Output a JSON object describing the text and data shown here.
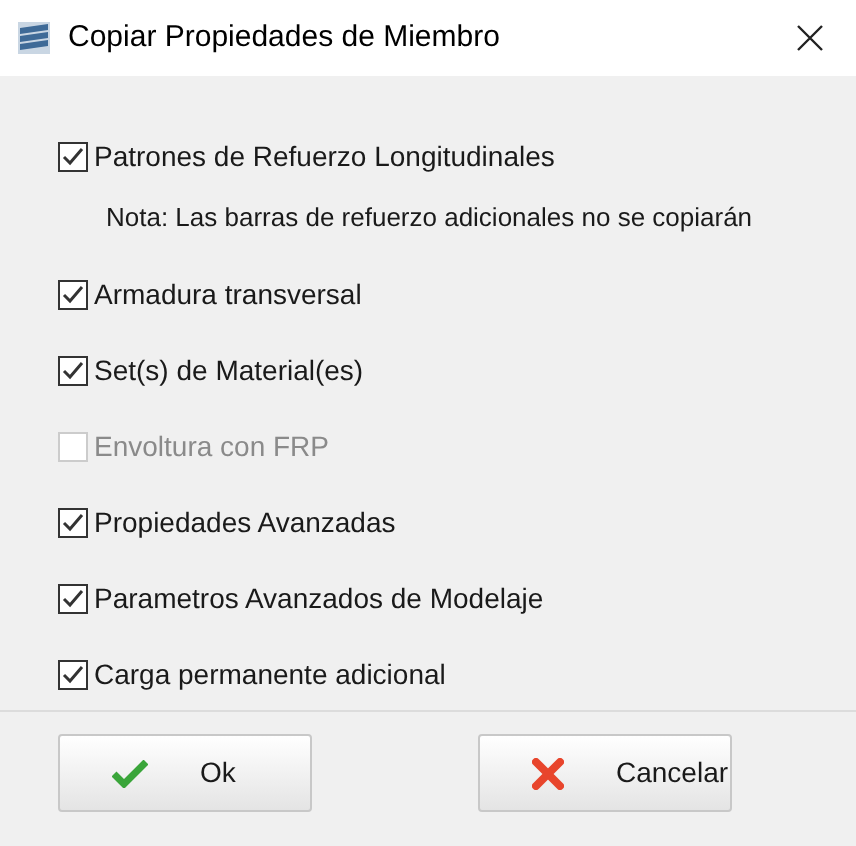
{
  "window": {
    "title": "Copiar Propiedades de Miembro"
  },
  "options": [
    {
      "label": "Patrones de Refuerzo Longitudinales",
      "checked": true,
      "disabled": false,
      "note": "Nota: Las barras de refuerzo adicionales no se copiarán"
    },
    {
      "label": "Armadura transversal",
      "checked": true,
      "disabled": false
    },
    {
      "label": "Set(s) de Material(es)",
      "checked": true,
      "disabled": false
    },
    {
      "label": "Envoltura con FRP",
      "checked": false,
      "disabled": true
    },
    {
      "label": "Propiedades Avanzadas",
      "checked": true,
      "disabled": false
    },
    {
      "label": "Parametros Avanzados de Modelaje",
      "checked": true,
      "disabled": false
    },
    {
      "label": "Carga permanente adicional",
      "checked": true,
      "disabled": false
    }
  ],
  "buttons": [
    {
      "label": "Ok",
      "kind": "ok"
    },
    {
      "label": "Cancelar",
      "kind": "cancel"
    }
  ]
}
